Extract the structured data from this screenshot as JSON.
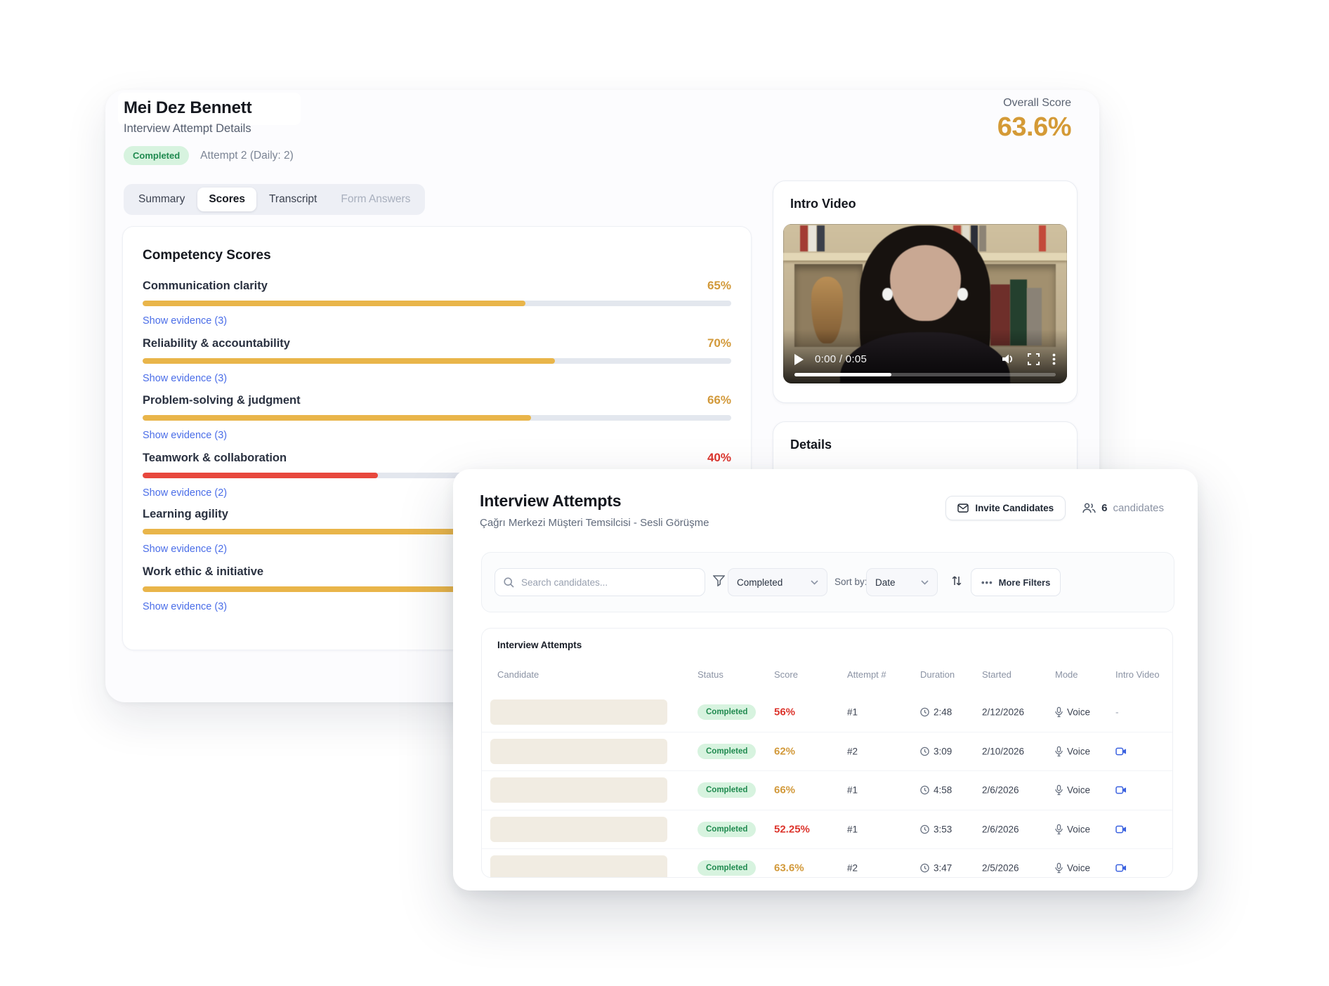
{
  "colors": {
    "amber": "#d2993a",
    "red": "#dc342c",
    "bar_amber": "#e9b54a",
    "bar_red": "#e8473d",
    "link_blue": "#4b6ee8",
    "badge_bg": "#d7f3df",
    "badge_text": "#1f8a4f"
  },
  "detail_panel": {
    "name": "Mei Dez Bennett",
    "subtitle": "Interview Attempt Details",
    "status": "Completed",
    "attempt_info": "Attempt 2 (Daily: 2)",
    "tabs": [
      {
        "label": "Summary",
        "state": "normal"
      },
      {
        "label": "Scores",
        "state": "active"
      },
      {
        "label": "Transcript",
        "state": "normal"
      },
      {
        "label": "Form Answers",
        "state": "muted"
      }
    ],
    "overall_score": {
      "label": "Overall Score",
      "value": "63.6%"
    },
    "competency": {
      "title": "Competency Scores",
      "rows": [
        {
          "label": "Communication clarity",
          "value": "65%",
          "pct": 65,
          "tone": "amber",
          "evidence": "Show evidence (3)"
        },
        {
          "label": "Reliability & accountability",
          "value": "70%",
          "pct": 70,
          "tone": "amber",
          "evidence": "Show evidence (3)"
        },
        {
          "label": "Problem-solving & judgment",
          "value": "66%",
          "pct": 66,
          "tone": "amber",
          "evidence": "Show evidence (3)"
        },
        {
          "label": "Teamwork & collaboration",
          "value": "40%",
          "pct": 40,
          "tone": "red",
          "evidence": "Show evidence (2)"
        },
        {
          "label": "Learning agility",
          "value": "",
          "pct": 76,
          "tone": "amber",
          "evidence": "Show evidence (2)"
        },
        {
          "label": "Work ethic & initiative",
          "value": "",
          "pct": 78,
          "tone": "amber",
          "evidence": "Show evidence (3)"
        }
      ]
    },
    "intro_video": {
      "title": "Intro Video",
      "time_display": "0:00 / 0:05",
      "progress_pct": 37
    },
    "details": {
      "title": "Details"
    }
  },
  "attempts_panel": {
    "title": "Interview Attempts",
    "subtitle": "Çağrı Merkezi Müşteri Temsilcisi - Sesli Görüşme",
    "invite_button": "Invite Candidates",
    "candidate_count": "6",
    "candidate_count_label": "candidates",
    "toolbar": {
      "search_placeholder": "Search candidates...",
      "status_filter": "Completed",
      "sort_by_label": "Sort by:",
      "sort_value": "Date",
      "more_filters_label": "More Filters"
    },
    "table": {
      "title": "Interview Attempts",
      "columns": [
        "Candidate",
        "Status",
        "Score",
        "Attempt #",
        "Duration",
        "Started",
        "Mode",
        "Intro Video"
      ],
      "rows": [
        {
          "status": "Completed",
          "score": "56%",
          "tone": "red",
          "attempt": "#1",
          "duration": "2:48",
          "started": "2/12/2026",
          "mode": "Voice",
          "intro_video": "none"
        },
        {
          "status": "Completed",
          "score": "62%",
          "tone": "amber",
          "attempt": "#2",
          "duration": "3:09",
          "started": "2/10/2026",
          "mode": "Voice",
          "intro_video": "video"
        },
        {
          "status": "Completed",
          "score": "66%",
          "tone": "amber",
          "attempt": "#1",
          "duration": "4:58",
          "started": "2/6/2026",
          "mode": "Voice",
          "intro_video": "video"
        },
        {
          "status": "Completed",
          "score": "52.25%",
          "tone": "red",
          "attempt": "#1",
          "duration": "3:53",
          "started": "2/6/2026",
          "mode": "Voice",
          "intro_video": "video"
        },
        {
          "status": "Completed",
          "score": "63.6%",
          "tone": "amber",
          "attempt": "#2",
          "duration": "3:47",
          "started": "2/5/2026",
          "mode": "Voice",
          "intro_video": "video"
        }
      ]
    }
  }
}
